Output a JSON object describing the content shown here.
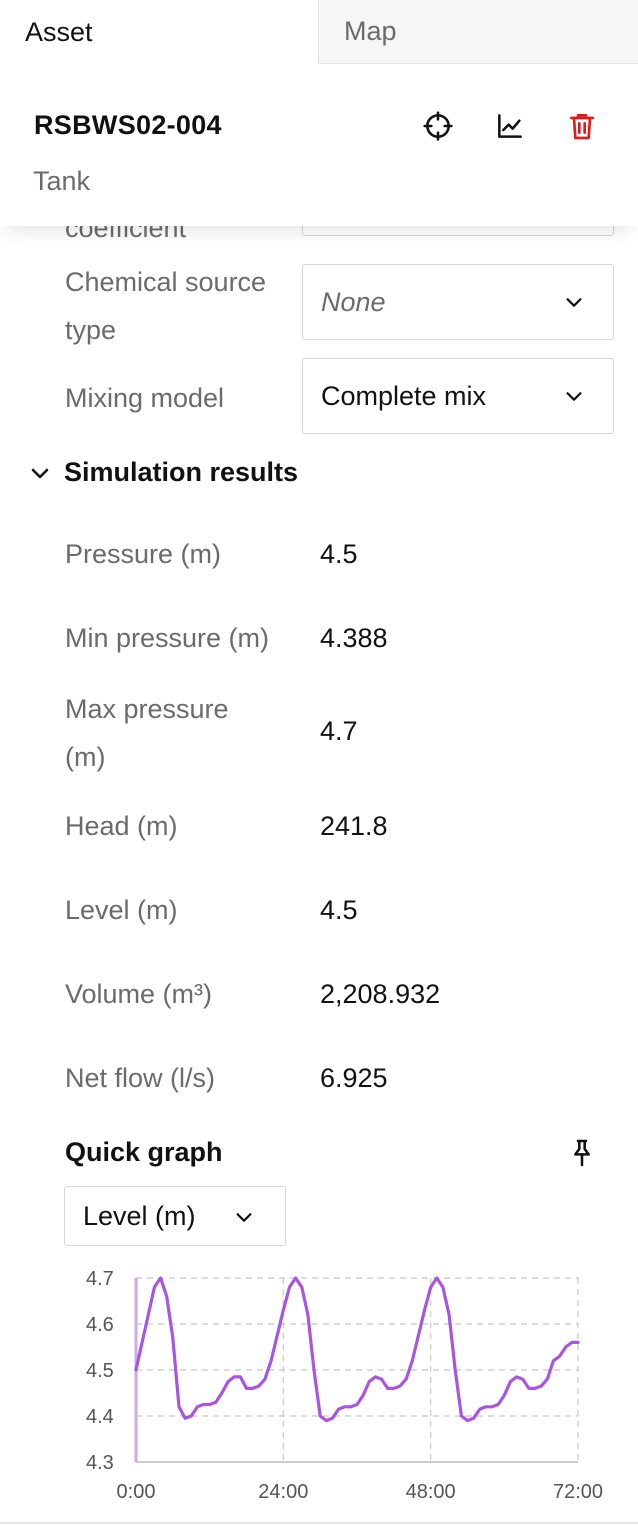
{
  "tabs": [
    {
      "label": "Asset",
      "active": true
    },
    {
      "label": "Map",
      "active": false
    }
  ],
  "asset": {
    "title": "RSBWS02-004",
    "type": "Tank",
    "icons": [
      "target-icon",
      "chart-icon",
      "trash-icon"
    ],
    "delete_color": "#e01b1b"
  },
  "properties": {
    "cut_label": "coefficient",
    "chemical_source_type": {
      "label": "Chemical source type",
      "value": "None"
    },
    "mixing_model": {
      "label": "Mixing model",
      "value": "Complete mix"
    }
  },
  "simulation": {
    "title": "Simulation results",
    "rows": [
      {
        "label": "Pressure (m)",
        "value": "4.5"
      },
      {
        "label": "Min pressure (m)",
        "value": "4.388"
      },
      {
        "label": "Max pressure (m)",
        "value": "4.7"
      },
      {
        "label": "Head (m)",
        "value": "241.8"
      },
      {
        "label": "Level (m)",
        "value": "4.5"
      },
      {
        "label": "Volume (m³)",
        "value": "2,208.932"
      },
      {
        "label": "Net flow (l/s)",
        "value": "6.925"
      }
    ]
  },
  "quick_graph": {
    "title": "Quick graph",
    "selected": "Level (m)"
  },
  "chart_data": {
    "type": "line",
    "title": "",
    "xlabel": "",
    "ylabel": "",
    "xlim": [
      0,
      72
    ],
    "ylim": [
      4.3,
      4.7
    ],
    "xticks": [
      "0:00",
      "24:00",
      "48:00",
      "72:00"
    ],
    "yticks": [
      "4.3",
      "4.4",
      "4.5",
      "4.6",
      "4.7"
    ],
    "grid": true,
    "color": "#a855e0",
    "series": [
      {
        "x": [
          0,
          1,
          2,
          3,
          4,
          5,
          6,
          7,
          8,
          9,
          10,
          11,
          12,
          13,
          14,
          15,
          16,
          17,
          18,
          19,
          20,
          21,
          22,
          23,
          24,
          25,
          26,
          27,
          28,
          29,
          30,
          31,
          32,
          33,
          34,
          35,
          36,
          37,
          38,
          39,
          40,
          41,
          42,
          43,
          44,
          45,
          46,
          47,
          48,
          49,
          50,
          51,
          52,
          53,
          54,
          55,
          56,
          57,
          58,
          59,
          60,
          61,
          62,
          63,
          64,
          65,
          66,
          67,
          68,
          69,
          70,
          71,
          72
        ],
        "y": [
          4.5,
          4.56,
          4.62,
          4.68,
          4.7,
          4.66,
          4.57,
          4.42,
          4.395,
          4.4,
          4.42,
          4.425,
          4.425,
          4.43,
          4.45,
          4.475,
          4.485,
          4.485,
          4.46,
          4.46,
          4.465,
          4.48,
          4.52,
          4.575,
          4.63,
          4.68,
          4.7,
          4.68,
          4.62,
          4.5,
          4.4,
          4.39,
          4.395,
          4.415,
          4.42,
          4.42,
          4.425,
          4.445,
          4.475,
          4.485,
          4.48,
          4.46,
          4.46,
          4.465,
          4.48,
          4.52,
          4.575,
          4.63,
          4.68,
          4.7,
          4.68,
          4.62,
          4.5,
          4.4,
          4.39,
          4.395,
          4.415,
          4.42,
          4.42,
          4.425,
          4.445,
          4.475,
          4.485,
          4.48,
          4.46,
          4.46,
          4.465,
          4.48,
          4.52,
          4.53,
          4.55,
          4.56,
          4.56
        ]
      }
    ]
  }
}
